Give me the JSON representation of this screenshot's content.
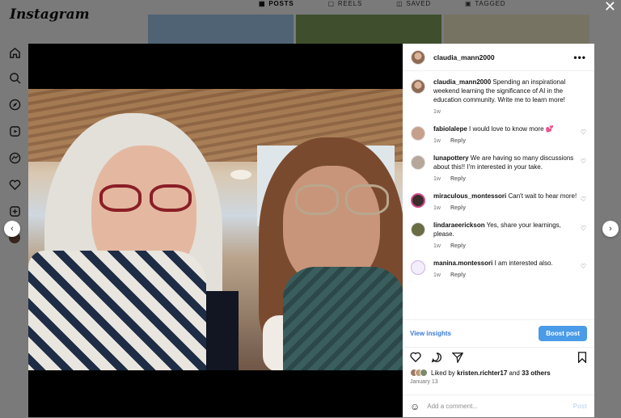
{
  "app": {
    "logo": "Instagram"
  },
  "profile_tabs": [
    "POSTS",
    "REELS",
    "SAVED",
    "TAGGED"
  ],
  "sidebar_icons": [
    "home-icon",
    "search-icon",
    "explore-icon",
    "reels-icon",
    "messages-icon",
    "notifications-icon",
    "create-icon"
  ],
  "post": {
    "username": "claudia_mann2000",
    "caption_user": "claudia_mann2000",
    "caption": "Spending an inspirational weekend learning the significance of AI in the education community. Write me to learn more!",
    "caption_time": "1w",
    "comments": [
      {
        "user": "fabiolalepe",
        "text": "I would love to know more 💕",
        "time": "1w",
        "reply": "Reply"
      },
      {
        "user": "lunapottery",
        "text": "We are having so many discussions about this!! I'm interested in your take.",
        "time": "1w",
        "reply": "Reply"
      },
      {
        "user": "miraculous_montessori",
        "text": "Can't wait to hear more!",
        "time": "1w",
        "reply": "Reply"
      },
      {
        "user": "lindaraeerickson",
        "text": "Yes, share your learnings, please.",
        "time": "1w",
        "reply": "Reply"
      },
      {
        "user": "manina.montessori",
        "text": "I am interested also.",
        "time": "1w",
        "reply": "Reply"
      }
    ],
    "insights_label": "View insights",
    "boost_label": "Boost post",
    "liked_by_prefix": "Liked by",
    "liked_by_user": "kristen.richter17",
    "liked_by_and": "and",
    "liked_by_others": "33 others",
    "date": "January 13",
    "add_comment_placeholder": "Add a comment...",
    "post_label": "Post"
  },
  "colors": {
    "link_blue": "#3a7bd5",
    "boost_blue": "#4a9be8"
  }
}
